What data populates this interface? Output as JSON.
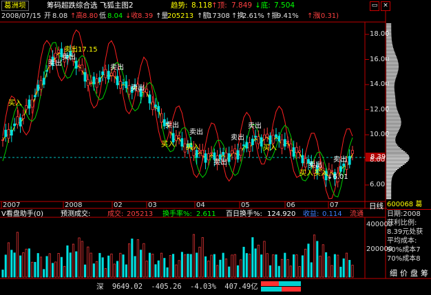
{
  "header": {
    "stock_name": "葛洲坝",
    "title": "筹码超跌综合选 飞狐主图2",
    "trend_label": "趋势:",
    "trend_value": "8.118",
    "top_label": "↑顶:",
    "top_value": "7.849",
    "bottom_label": "↓底:",
    "bottom_value": "7.504",
    "window_buttons": [
      "▭",
      "×"
    ]
  },
  "info": {
    "date": "2008/07/15",
    "open_label": "开",
    "open": "8.08",
    "high_label": "↑高",
    "high": "8.80",
    "low_label": "低",
    "low": "8.04",
    "close_label": "↓收",
    "close": "8.39",
    "vol_label": "↑量",
    "vol": "205213",
    "amt_label": "↑额",
    "amt": "17308",
    "turn_label": "↑换",
    "turn": "2.61%",
    "amp_label": "↑振",
    "amp": "9.41%",
    "chg_label": "↑涨",
    "chg": "(0.31)"
  },
  "price_axis": {
    "ticks": [
      "18.00",
      "16.00",
      "14.00",
      "12.00",
      "10.00",
      "8.00",
      "6.00"
    ],
    "current_price": "8.39"
  },
  "annotations": {
    "high_marker": "卖出17.15",
    "low_marker": "↓6.01",
    "buy": "买入",
    "sell": "卖出"
  },
  "time_axis": {
    "labels": [
      "2007",
      "2008",
      "02",
      "03",
      "04",
      "05",
      "06",
      "07"
    ],
    "period": "日线"
  },
  "volume_header": {
    "name": "V看盘助手(0)",
    "forecast_label": "预测成交:",
    "vol_label": "成交:",
    "vol": "205213",
    "turnover_label": "换手率%:",
    "turnover": "2.611",
    "hundred_label": "百日换手%:",
    "hundred": "124.920",
    "profit_label": "收益:",
    "profit": "0.114",
    "flow_label": "流通"
  },
  "volume_axis": {
    "ticks": [
      "400000",
      "200000"
    ]
  },
  "side_panel": {
    "code": "600068 葛",
    "lines": [
      "日期:2008",
      "获利比例:",
      "8.39元处获",
      "平均成本:",
      "90%成本7",
      "70%成本8"
    ],
    "tabs": [
      "细",
      "价",
      "盘",
      "筹"
    ]
  },
  "status_bar": {
    "market": "深",
    "index": "9649.02",
    "change": "-405.26",
    "pct": "-4.03%",
    "amount": "407.49亿"
  },
  "colors": {
    "up": "#ff3b3b",
    "down": "#00e0e0",
    "axis": "#c00000",
    "yellow": "#ffff00",
    "green_band": "#00c800",
    "label_orange": "#ffaa00"
  }
}
